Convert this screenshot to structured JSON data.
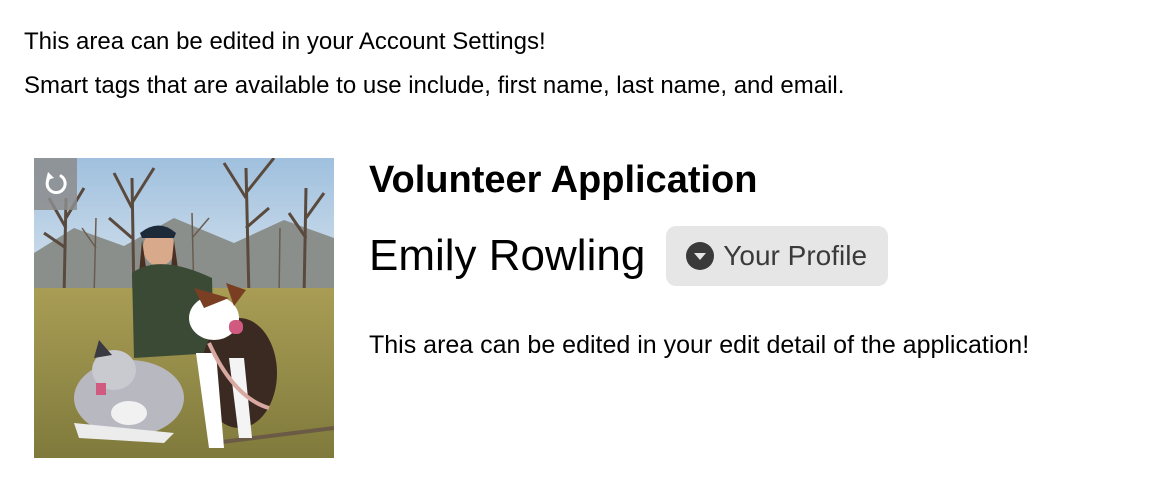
{
  "intro": {
    "line1": "This area can be edited in your Account Settings!",
    "line2": "Smart tags that are available to use include, first name, last name, and email."
  },
  "profile": {
    "title": "Volunteer Application",
    "name": "Emily Rowling",
    "profile_button_label": "Your Profile",
    "profile_button_icon": "chevron-down-circle-icon",
    "photo_control_icon": "rotate-icon",
    "edit_note": "This area can be edited in your edit detail of the application!"
  },
  "colors": {
    "button_bg": "#e6e6e6",
    "button_text": "#3a3a3a",
    "overlay_bg": "#8c8c8c"
  }
}
